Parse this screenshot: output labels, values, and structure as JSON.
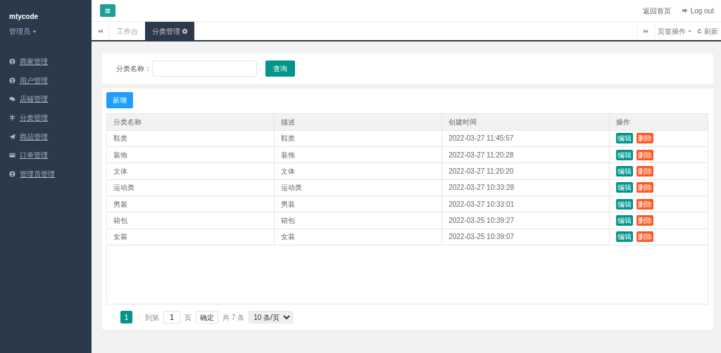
{
  "sidebar": {
    "brand": "mtycode",
    "user": "管理员",
    "items": [
      {
        "label": "商家管理"
      },
      {
        "label": "用户管理"
      },
      {
        "label": "店铺管理"
      },
      {
        "label": "分类管理"
      },
      {
        "label": "商品管理"
      },
      {
        "label": "订单管理"
      },
      {
        "label": "管理员管理"
      }
    ]
  },
  "header": {
    "links": [
      "返回首页",
      "Log out"
    ]
  },
  "tabs": [
    {
      "label": "工作台",
      "selected": false
    },
    {
      "label": "分类管理",
      "selected": true
    }
  ],
  "tab_actions": {
    "menu": "页签操作",
    "refresh": "刷新"
  },
  "search": {
    "label": "分类名称：",
    "button": "查询"
  },
  "table": {
    "add_button": "新增",
    "columns": [
      "分类名称",
      "描述",
      "创建时间",
      "操作"
    ],
    "rows": [
      {
        "cells": [
          "鞋类",
          "鞋类",
          "2022-03-27 11:45:57"
        ],
        "actions": [
          "编辑",
          "删除"
        ]
      },
      {
        "cells": [
          "装饰",
          "装饰",
          "2022-03-27 11:20:28"
        ],
        "actions": [
          "编辑",
          "删除"
        ]
      },
      {
        "cells": [
          "文体",
          "文体",
          "2022-03-27 11:20:20"
        ],
        "actions": [
          "编辑",
          "删除"
        ]
      },
      {
        "cells": [
          "运动类",
          "运动类",
          "2022-03-27 10:33:28"
        ],
        "actions": [
          "编辑",
          "删除"
        ]
      },
      {
        "cells": [
          "男装",
          "男装",
          "2022-03-27 10:33:01"
        ],
        "actions": [
          "编辑",
          "删除"
        ]
      },
      {
        "cells": [
          "箱包",
          "箱包",
          "2022-03-25 10:39:27"
        ],
        "actions": [
          "编辑",
          "删除"
        ]
      },
      {
        "cells": [
          "女装",
          "女装",
          "2022-03-25 10:39:07"
        ],
        "actions": [
          "编辑",
          "删除"
        ]
      }
    ]
  },
  "pagination": {
    "pages": [
      {
        "label": "1",
        "selected": true
      }
    ],
    "goto_label": "到第",
    "page_value": "1",
    "page_unit": "页",
    "confirm": "确定",
    "total": "共 7 条",
    "page_size": "10 条/页"
  }
}
